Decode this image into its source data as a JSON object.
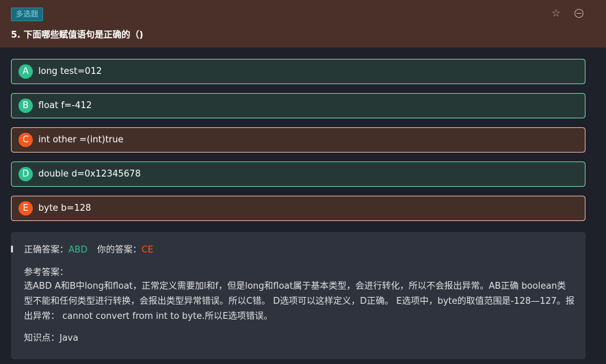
{
  "header": {
    "tag": "多选题",
    "question": "5. 下面哪些赋值语句是正确的（)"
  },
  "options": [
    {
      "letter": "A",
      "text": "long test=012",
      "status": "correct"
    },
    {
      "letter": "B",
      "text": "float f=-412",
      "status": "correct"
    },
    {
      "letter": "C",
      "text": "int other =(int)true",
      "status": "wrong"
    },
    {
      "letter": "D",
      "text": "double d=0x12345678",
      "status": "correct"
    },
    {
      "letter": "E",
      "text": "byte b=128",
      "status": "wrong"
    }
  ],
  "analysis": {
    "correct_label": "正确答案：",
    "correct_value": "ABD",
    "yours_label": "你的答案：",
    "yours_value": "CE",
    "ref_label": "参考答案：",
    "ref_text": "选ABD A和B中long和float，正常定义需要加l和f，但是long和float属于基本类型，会进行转化，所以不会报出异常。AB正确 boolean类型不能和任何类型进行转换，会报出类型异常错误。所以C错。 D选项可以这样定义，D正确。 E选项中，byte的取值范围是-128—127。报出异常： cannot convert from int to byte.所以E选项错误。",
    "knowledge": "知识点：Java"
  },
  "colors": {
    "correct": "#2ec08f",
    "wrong": "#f2581f",
    "header_bg": "#4a3028"
  },
  "icons": [
    "star-icon",
    "minus-circle-icon"
  ]
}
